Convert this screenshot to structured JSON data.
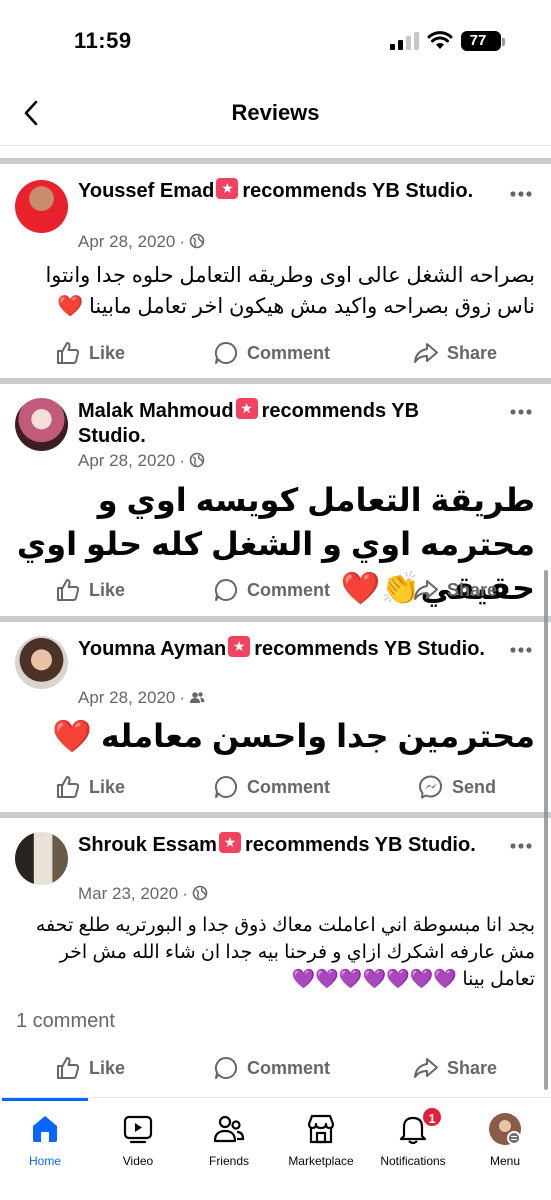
{
  "status": {
    "time": "11:59",
    "battery": "77"
  },
  "header": {
    "title": "Reviews"
  },
  "reviews": [
    {
      "name": "Youssef Emad",
      "recommends": "recommends YB Studio.",
      "date": "Apr 28, 2020",
      "privacy_icon": "globe-icon",
      "text": "بصراحه الشغل عالى اوى وطريقه التعامل حلوه جدا وانتوا ناس زوق بصراحه واكيد مش هيكون اخر تعامل مابينا ❤️",
      "actions": [
        "Like",
        "Comment",
        "Share"
      ]
    },
    {
      "name": "Malak Mahmoud",
      "recommends": "recommends YB Studio.",
      "date": "Apr 28, 2020",
      "privacy_icon": "globe-icon",
      "text": "طريقة التعامل كويسه اوي و محترمه اوي و الشغل كله حلو اوي حقيقي👏❤️",
      "actions": [
        "Like",
        "Comment",
        "Share"
      ]
    },
    {
      "name": "Youmna Ayman",
      "recommends": "recommends YB Studio.",
      "date": "Apr 28, 2020",
      "privacy_icon": "friends-icon",
      "text": "محترمين جدا واحسن معامله ❤️",
      "actions": [
        "Like",
        "Comment",
        "Send"
      ]
    },
    {
      "name": "Shrouk Essam",
      "recommends": "recommends YB Studio.",
      "date": "Mar 23, 2020",
      "privacy_icon": "globe-icon",
      "text": "بجد انا مبسوطة اني اعاملت معاك ذوق جدا و البورتريه طلع تحفه مش عارفه اشكرك ازاي و فرحنا بيه جدا ان شاء الله مش اخر تعامل بينا 💜💜💜💜💜💜💜",
      "comment_count": "1 comment",
      "actions": [
        "Like",
        "Comment",
        "Share"
      ]
    }
  ],
  "tabs": [
    {
      "label": "Home",
      "icon": "home-icon",
      "active": true
    },
    {
      "label": "Video",
      "icon": "video-icon"
    },
    {
      "label": "Friends",
      "icon": "friends-icon"
    },
    {
      "label": "Marketplace",
      "icon": "marketplace-icon"
    },
    {
      "label": "Notifications",
      "icon": "bell-icon",
      "badge": "1"
    },
    {
      "label": "Menu",
      "icon": "menu-avatar-icon"
    }
  ],
  "colors": {
    "accent": "#0866ff",
    "badge": "#e41e3f",
    "recommend": "#f3425f",
    "muted": "#65676b"
  }
}
